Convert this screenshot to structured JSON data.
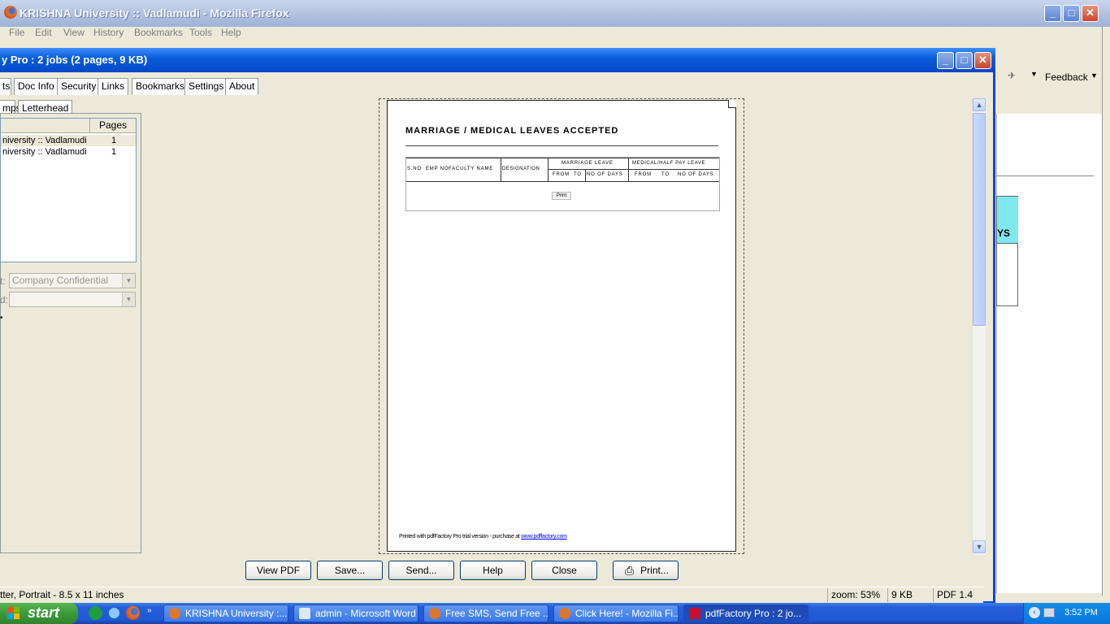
{
  "firefox": {
    "title": "KRISHNA University :: Vadlamudi - Mozilla Firefox",
    "menu": [
      "File",
      "Edit",
      "View",
      "History",
      "Bookmarks",
      "Tools",
      "Help"
    ],
    "feedback_label": "Feedback",
    "table_fragment": "YS"
  },
  "pdffactory": {
    "title": "y Pro : 2 jobs (2 pages, 9 KB)",
    "tabs": [
      "ts",
      "Doc Info",
      "Security",
      "Links",
      "Bookmarks",
      "Settings",
      "About"
    ],
    "subtabs": [
      "mps",
      "Letterhead"
    ],
    "joblist": {
      "header_pages": "Pages",
      "rows": [
        {
          "name": "niversity :: Vadlamudi",
          "pages": "1"
        },
        {
          "name": "niversity :: Vadlamudi",
          "pages": "1"
        }
      ]
    },
    "stamp_label": "t:",
    "stamp_value": "Company Confidential",
    "field2_label": "d:",
    "document": {
      "heading": "MARRIAGE / MEDICAL LEAVES ACCEPTED",
      "col_sno": "S.NO",
      "col_empno": "EMP NO",
      "col_faculty": "FACULTY NAME",
      "col_designation": "DESIGNATION",
      "col_marriage": "MARRIAGE LEAVE",
      "col_medical": "MEDICAL/HALF PAY LEAVE",
      "sub_from": "FROM",
      "sub_to": "TO",
      "sub_days": "NO OF DAYS",
      "print_label": "Print",
      "footer_text": "Printed with pdfFactory Pro trial version - purchase at ",
      "footer_link": "www.pdffactory.com"
    },
    "buttons": [
      "View PDF",
      "Save...",
      "Send...",
      "Help",
      "Close",
      "Print..."
    ],
    "status": {
      "paper": "tter, Portrait - 8.5 x 11 inches",
      "zoom": "zoom: 53%",
      "size": "9 KB",
      "pdf_version": "PDF 1.4"
    }
  },
  "taskbar": {
    "start_label": "start",
    "tasks": [
      "KRISHNA University :...",
      "admin - Microsoft Word",
      "Free SMS, Send Free ...",
      "Click Here! - Mozilla Fi...",
      "pdfFactory Pro : 2 jo..."
    ],
    "clock": "3:52 PM"
  },
  "colors": {
    "titlebar_active": "#0a5fdc",
    "taskbar": "#245edb",
    "start_green": "#3c9a3a"
  }
}
